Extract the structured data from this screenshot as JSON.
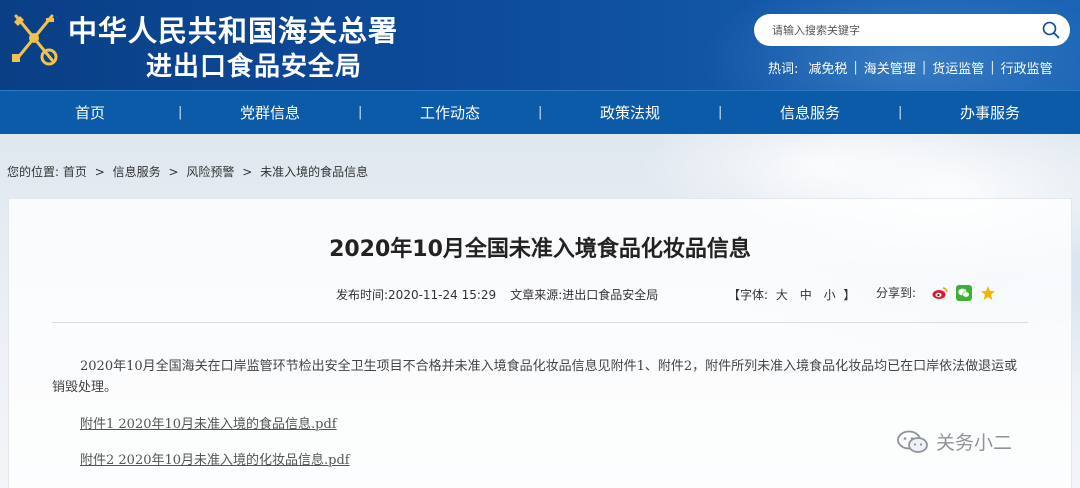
{
  "header": {
    "title_line1": "中华人民共和国海关总署",
    "title_line2": "进出口食品安全局",
    "emblem_icon": "customs-emblem-icon",
    "search": {
      "placeholder": "请输入搜索关键字",
      "value": "",
      "icon": "search-icon"
    },
    "hotwords": {
      "label": "热词:",
      "items": [
        "减免税",
        "海关管理",
        "货运监管",
        "行政监管"
      ]
    }
  },
  "nav": {
    "items": [
      "首页",
      "党群信息",
      "工作动态",
      "政策法规",
      "信息服务",
      "办事服务"
    ]
  },
  "breadcrumb": {
    "label": "您的位置:",
    "items": [
      "首页",
      "信息服务",
      "风险预警",
      "未准入境的食品信息"
    ],
    "separator": ">"
  },
  "article": {
    "title": "2020年10月全国未准入境食品化妆品信息",
    "publish_label": "发布时间:",
    "publish_time": "2020-11-24 15:29",
    "source_label": "文章来源:",
    "source": "进出口食品安全局",
    "font_label_open": "【字体:",
    "font_sizes": [
      "大",
      "中",
      "小"
    ],
    "font_label_close": "】",
    "share_label": "分享到:",
    "share_icons": [
      "weibo-icon",
      "wechat-icon",
      "qzone-icon"
    ],
    "body": "2020年10月全国海关在口岸监管环节检出安全卫生项目不合格并未准入境食品化妆品信息见附件1、附件2，附件所列未准入境食品化妆品均已在口岸依法做退运或销毁处理。",
    "attachments": [
      "附件1  2020年10月未准入境的食品信息.pdf",
      "附件2  2020年10月未准入境的化妆品信息.pdf"
    ]
  },
  "watermark": {
    "icon": "wechat-official-account-icon",
    "text": "关务小二"
  },
  "colors": {
    "header_bg": "#0d4c9c",
    "nav_bg": "#0c5ba8",
    "weibo": "#e6162d",
    "wechat": "#3eb135",
    "qzone": "#f5b400"
  }
}
